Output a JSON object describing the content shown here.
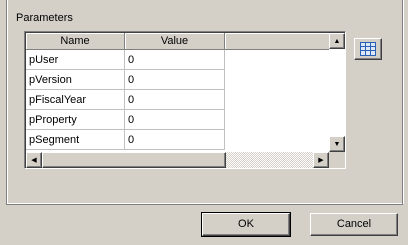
{
  "parameters": {
    "group_label": "Parameters",
    "columns": [
      "Name",
      "Value"
    ],
    "rows": [
      {
        "name": "pUser",
        "value": "0"
      },
      {
        "name": "pVersion",
        "value": "0"
      },
      {
        "name": "pFiscalYear",
        "value": "0"
      },
      {
        "name": "pProperty",
        "value": "0"
      },
      {
        "name": "pSegment",
        "value": "0"
      }
    ]
  },
  "icons": {
    "grid_button_icon": "grid-icon",
    "scroll_up": "arrow-up-icon",
    "scroll_down": "arrow-down-icon",
    "scroll_left": "arrow-left-icon",
    "scroll_right": "arrow-right-icon"
  },
  "buttons": {
    "ok_label": "OK",
    "cancel_label": "Cancel"
  }
}
